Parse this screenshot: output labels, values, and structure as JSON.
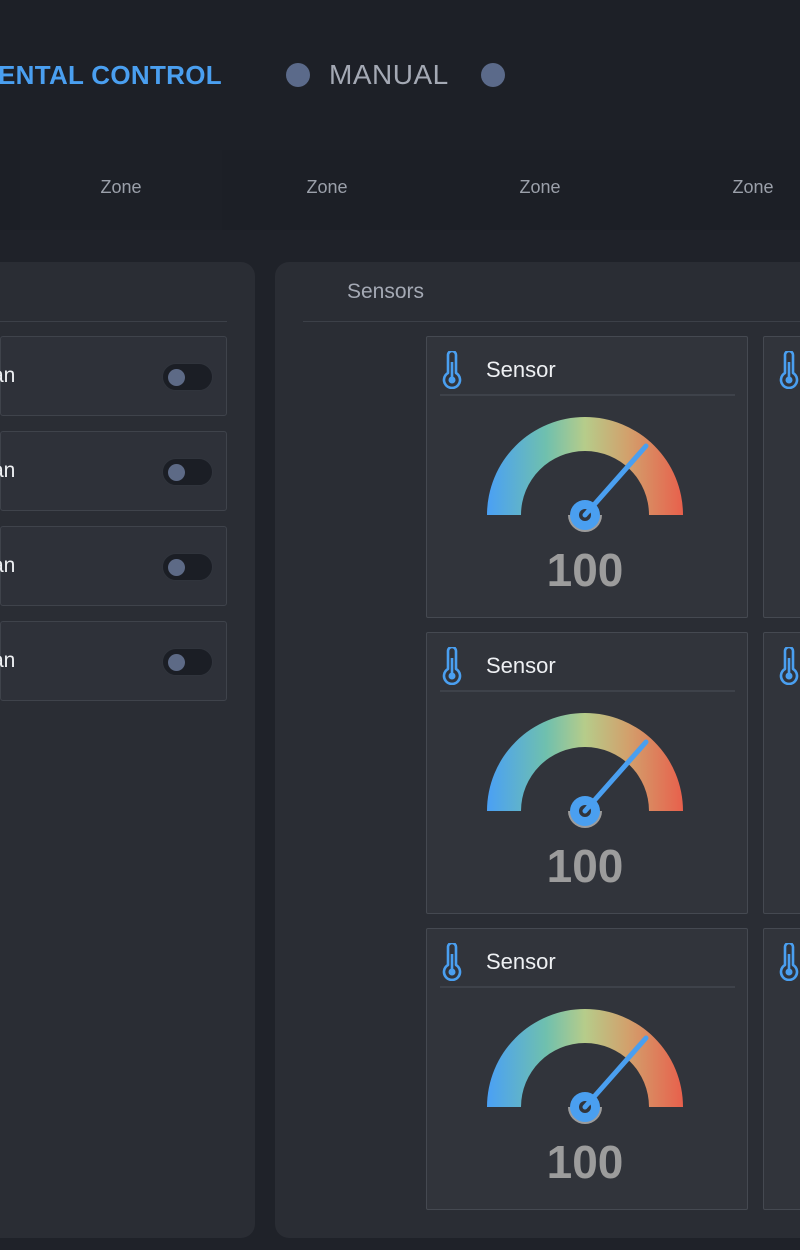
{
  "header": {
    "title": "ENTAL CONTROL",
    "mode_label": "MANUAL"
  },
  "zones": [
    {
      "label": "Zone"
    },
    {
      "label": "Zone"
    },
    {
      "label": "Zone"
    },
    {
      "label": "Zone"
    }
  ],
  "fans": {
    "items": [
      {
        "label": "an",
        "on": false
      },
      {
        "label": "an",
        "on": false
      },
      {
        "label": "an",
        "on": false
      },
      {
        "label": "an",
        "on": false
      }
    ]
  },
  "sensors": {
    "title": "Sensors",
    "cards": [
      {
        "title": "Sensor",
        "value": "100",
        "icon": "thermometer-icon"
      },
      {
        "title": "Sensor",
        "value": "100",
        "icon": "thermometer-icon"
      },
      {
        "title": "Sensor",
        "value": "100",
        "icon": "thermometer-icon"
      }
    ]
  },
  "colors": {
    "accent": "#4a9ff0",
    "background": "#1f2229",
    "panel": "#2a2d34",
    "toggle_knob": "#5d6a86",
    "gauge_value": "#9c9c9c"
  }
}
